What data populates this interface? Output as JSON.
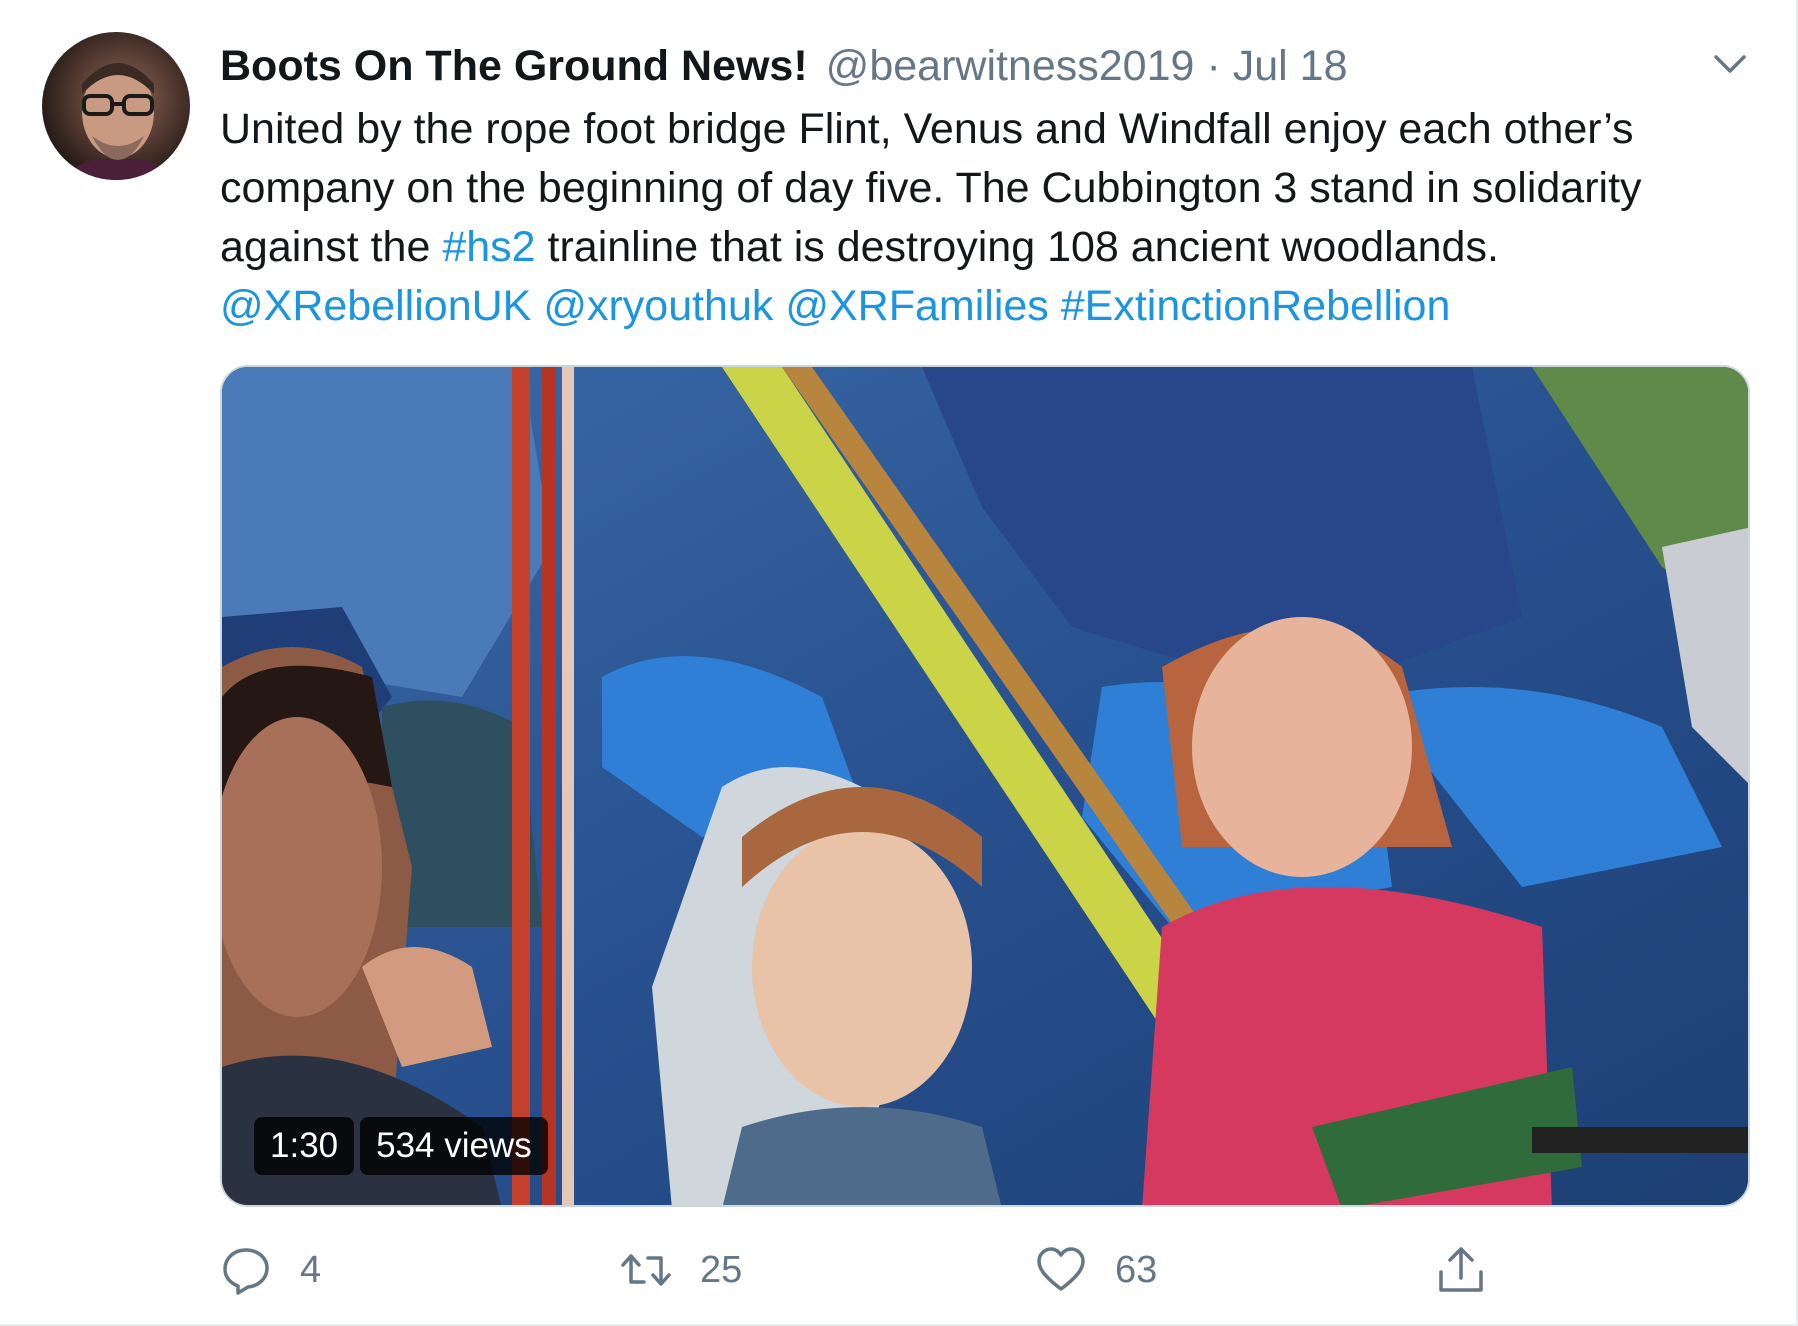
{
  "author": {
    "display_name": "Boots On The Ground News!",
    "handle": "@bearwitness2019",
    "separator": "·",
    "date": "Jul 18",
    "avatar_icon": "avatar-photo"
  },
  "tweet_text": {
    "line1": "United by the rope foot bridge Flint, Venus and Windfall enjoy each other’s",
    "line2": "company on the beginning of day five. The Cubbington 3 stand in solidarity",
    "line3_before": "against the ",
    "line3_hashtag": "#hs2",
    "line3_after": " trainline that is destroying 108 ancient woodlands.",
    "mentions": [
      "@XRebellionUK",
      "@xryouthuk",
      "@XRFamilies",
      "#ExtinctionRebellion"
    ]
  },
  "video": {
    "duration": "1:30",
    "views": "534 views"
  },
  "actions": {
    "reply": {
      "icon": "reply-icon",
      "count": "4"
    },
    "retweet": {
      "icon": "retweet-icon",
      "count": "25"
    },
    "like": {
      "icon": "heart-icon",
      "count": "63"
    },
    "share": {
      "icon": "share-icon"
    }
  },
  "colors": {
    "link": "#1b95e0",
    "secondary_text": "#657786",
    "primary_text": "#14171a",
    "border": "#e6ecf0"
  }
}
